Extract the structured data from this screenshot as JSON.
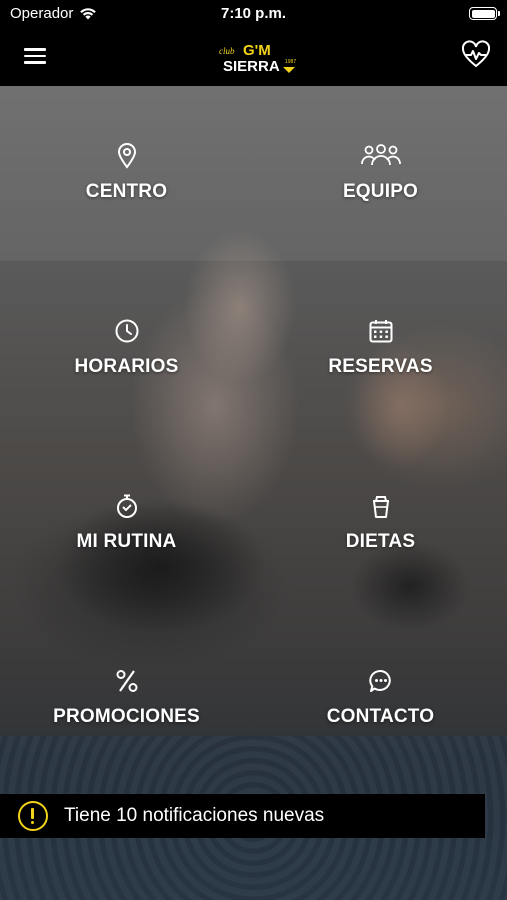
{
  "status_bar": {
    "carrier": "Operador",
    "time": "7:10 p.m.",
    "icons": [
      "wifi-icon",
      "battery-icon"
    ]
  },
  "header": {
    "logo_text_top": "club G'M",
    "logo_text_bottom": "SIERRA",
    "logo_year": "1987",
    "menu_icon": "hamburger-icon",
    "health_icon": "heart-pulse-icon",
    "logo_accent": "#f2d21b"
  },
  "menu": {
    "items": [
      {
        "label": "CENTRO",
        "icon": "location-pin-icon"
      },
      {
        "label": "EQUIPO",
        "icon": "team-icon"
      },
      {
        "label": "HORARIOS",
        "icon": "clock-icon"
      },
      {
        "label": "RESERVAS",
        "icon": "calendar-icon"
      },
      {
        "label": "MI RUTINA",
        "icon": "stopwatch-icon"
      },
      {
        "label": "DIETAS",
        "icon": "drink-cup-icon"
      },
      {
        "label": "PROMOCIONES",
        "icon": "percent-icon"
      },
      {
        "label": "CONTACTO",
        "icon": "chat-bubble-icon"
      }
    ]
  },
  "notification": {
    "text": "Tiene 10 notificaciones nuevas",
    "icon": "alert-icon",
    "accent": "#f2d21b"
  }
}
